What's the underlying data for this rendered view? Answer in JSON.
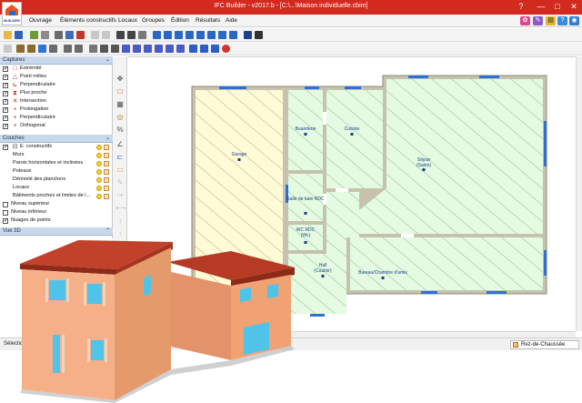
{
  "app": {
    "logo_text": "BUILDER",
    "title": "IFC Builder - v2017.b - [C:\\...\\Maison individuelle.cbim]"
  },
  "window_controls": {
    "help": "?",
    "minimize": "—",
    "maximize": "□",
    "close": "✕"
  },
  "menu": {
    "items": [
      "Ouvrage",
      "Éléments constructifs",
      "Locaux",
      "Groupes",
      "Édition",
      "Résultats",
      "Aide"
    ]
  },
  "panels": {
    "captures": {
      "title": "Captures",
      "items": [
        {
          "label": "Extrémité",
          "checked": true,
          "icon": "square-endpoint-icon"
        },
        {
          "label": "Point milieu",
          "checked": true,
          "icon": "triangle-midpoint-icon"
        },
        {
          "label": "Perpendiculaire",
          "checked": true,
          "icon": "perpendicular-icon"
        },
        {
          "label": "Plus proche",
          "checked": true,
          "icon": "hourglass-nearest-icon"
        },
        {
          "label": "Intersection",
          "checked": true,
          "icon": "x-intersection-icon"
        },
        {
          "label": "Prolongation",
          "checked": true,
          "icon": "plus-extension-icon"
        },
        {
          "label": "Perpendiculaire",
          "checked": true,
          "icon": "plus-perpendicular-icon"
        },
        {
          "label": "Orthogonal",
          "checked": true,
          "icon": "plus-orthogonal-icon"
        }
      ]
    },
    "layers": {
      "title": "Couches",
      "items": [
        {
          "label": "E. constructifs",
          "checked": true
        },
        {
          "label": "Murs"
        },
        {
          "label": "Parois horizontales et inclinées"
        },
        {
          "label": "Poteaux"
        },
        {
          "label": "Dénivelé des planchers"
        },
        {
          "label": "Locaux"
        },
        {
          "label": "Bâtiments proches et limites de l..."
        },
        {
          "label": "Niveau supérieur",
          "checked": false
        },
        {
          "label": "Niveau inférieur",
          "checked": false
        },
        {
          "label": "Nuages de points",
          "checked": true
        }
      ]
    },
    "view3d": {
      "title": "Vue 3D"
    }
  },
  "plan": {
    "rooms": [
      {
        "name": "Garage"
      },
      {
        "name": "Buanderie"
      },
      {
        "name": "Cuisine"
      },
      {
        "name": "Séjour",
        "sub": "(Salon)"
      },
      {
        "name": "Salle de bain RDC"
      },
      {
        "name": "WC RDC",
        "sub": "(Wc)"
      },
      {
        "name": "Hall",
        "sub": "(Couloir)"
      },
      {
        "name": "Bureau/Chambre d'amis"
      }
    ]
  },
  "status": {
    "left": "Sélection",
    "level": "Rez-de-Chaussée"
  },
  "colors": {
    "titlebar": "#d32a1f",
    "roof": "#b63a24",
    "facade": "#f2a878",
    "window_glass": "#4fc3e8",
    "room_fill": "#e4fbe1",
    "garage_fill": "#fffbd6",
    "wall": "#b8b6a3",
    "opening": "#2e6fd6",
    "room_label": "#1d3c8a"
  }
}
